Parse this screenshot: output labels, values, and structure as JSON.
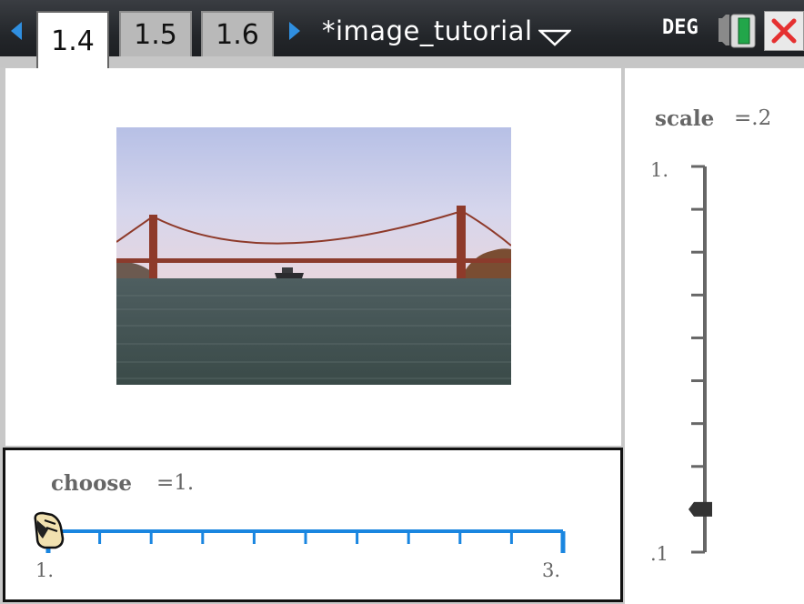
{
  "toolbar": {
    "tabs": [
      {
        "label": "1.4",
        "active": true
      },
      {
        "label": "1.5",
        "active": false
      },
      {
        "label": "1.6",
        "active": false
      }
    ],
    "document_title": "*image_tutorial",
    "angle_mode": "DEG",
    "icons": [
      "prev-page-icon",
      "next-page-icon",
      "dropdown-icon",
      "battery-icon",
      "close-icon"
    ],
    "accent_color": "#2f8fe0",
    "close_color": "#e53030"
  },
  "image": {
    "subject": "Golden Gate Bridge photograph"
  },
  "scale_slider": {
    "name": "scale",
    "value_text": "=.2",
    "value": 0.2,
    "min_label": ".1",
    "max_label": "1.",
    "min": 0.1,
    "max": 1.0,
    "orientation": "vertical",
    "tick_count": 10
  },
  "choose_slider": {
    "name": "choose",
    "value_text": "=1.",
    "value": 1,
    "min_label": "1.",
    "max_label": "3.",
    "min": 1,
    "max": 3,
    "orientation": "horizontal",
    "tick_count": 11,
    "track_color": "#1a86e0"
  }
}
